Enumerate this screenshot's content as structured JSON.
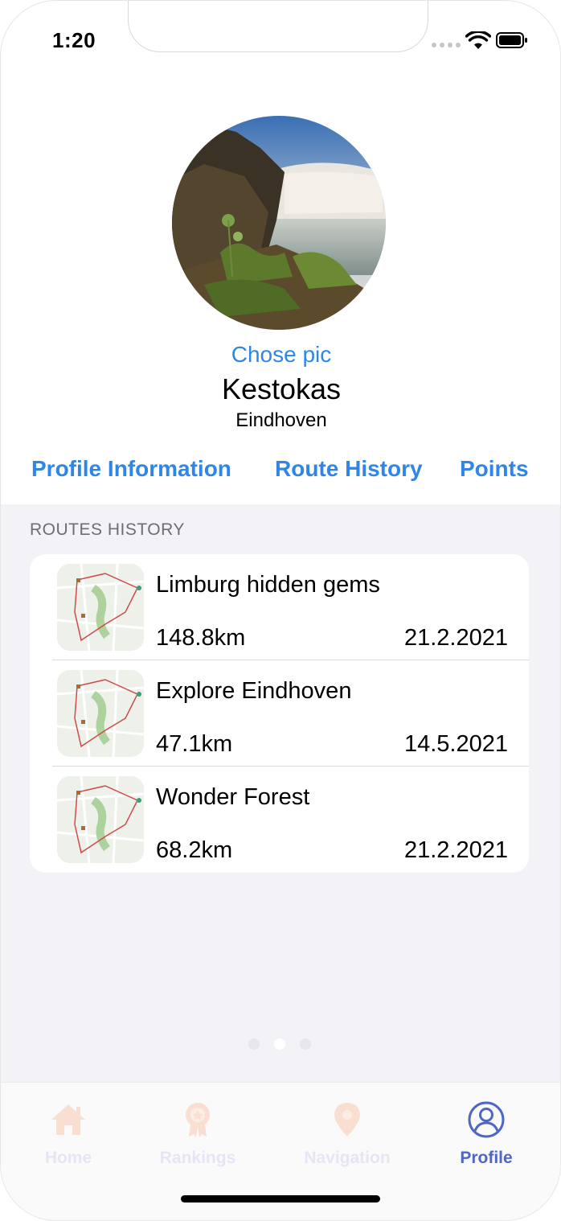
{
  "status_bar": {
    "time": "1:20"
  },
  "profile": {
    "choose_pic_label": "Chose pic",
    "username": "Kestokas",
    "city": "Eindhoven"
  },
  "tabs": [
    {
      "label": "Profile Information"
    },
    {
      "label": "Route History"
    },
    {
      "label": "Points"
    }
  ],
  "routes_section": {
    "title": "ROUTES HISTORY",
    "routes": [
      {
        "name": "Limburg hidden gems",
        "distance": "148.8km",
        "date": "21.2.2021"
      },
      {
        "name": "Explore Eindhoven",
        "distance": "47.1km",
        "date": "14.5.2021"
      },
      {
        "name": "Wonder Forest",
        "distance": "68.2km",
        "date": "21.2.2021"
      }
    ]
  },
  "page_indicator": {
    "count": 3,
    "active_index": 1
  },
  "tab_bar": {
    "items": [
      {
        "label": "Home",
        "icon": "house-icon",
        "active": false
      },
      {
        "label": "Rankings",
        "icon": "award-badge-icon",
        "active": false
      },
      {
        "label": "Navigation",
        "icon": "map-pin-icon",
        "active": false
      },
      {
        "label": "Profile",
        "icon": "person-circle-icon",
        "active": true
      }
    ],
    "inactive_icon_color": "#f8dfd2",
    "active_color": "#4e66c8"
  },
  "colors": {
    "accent": "#2f86e6",
    "background": "#f2f2f7"
  }
}
